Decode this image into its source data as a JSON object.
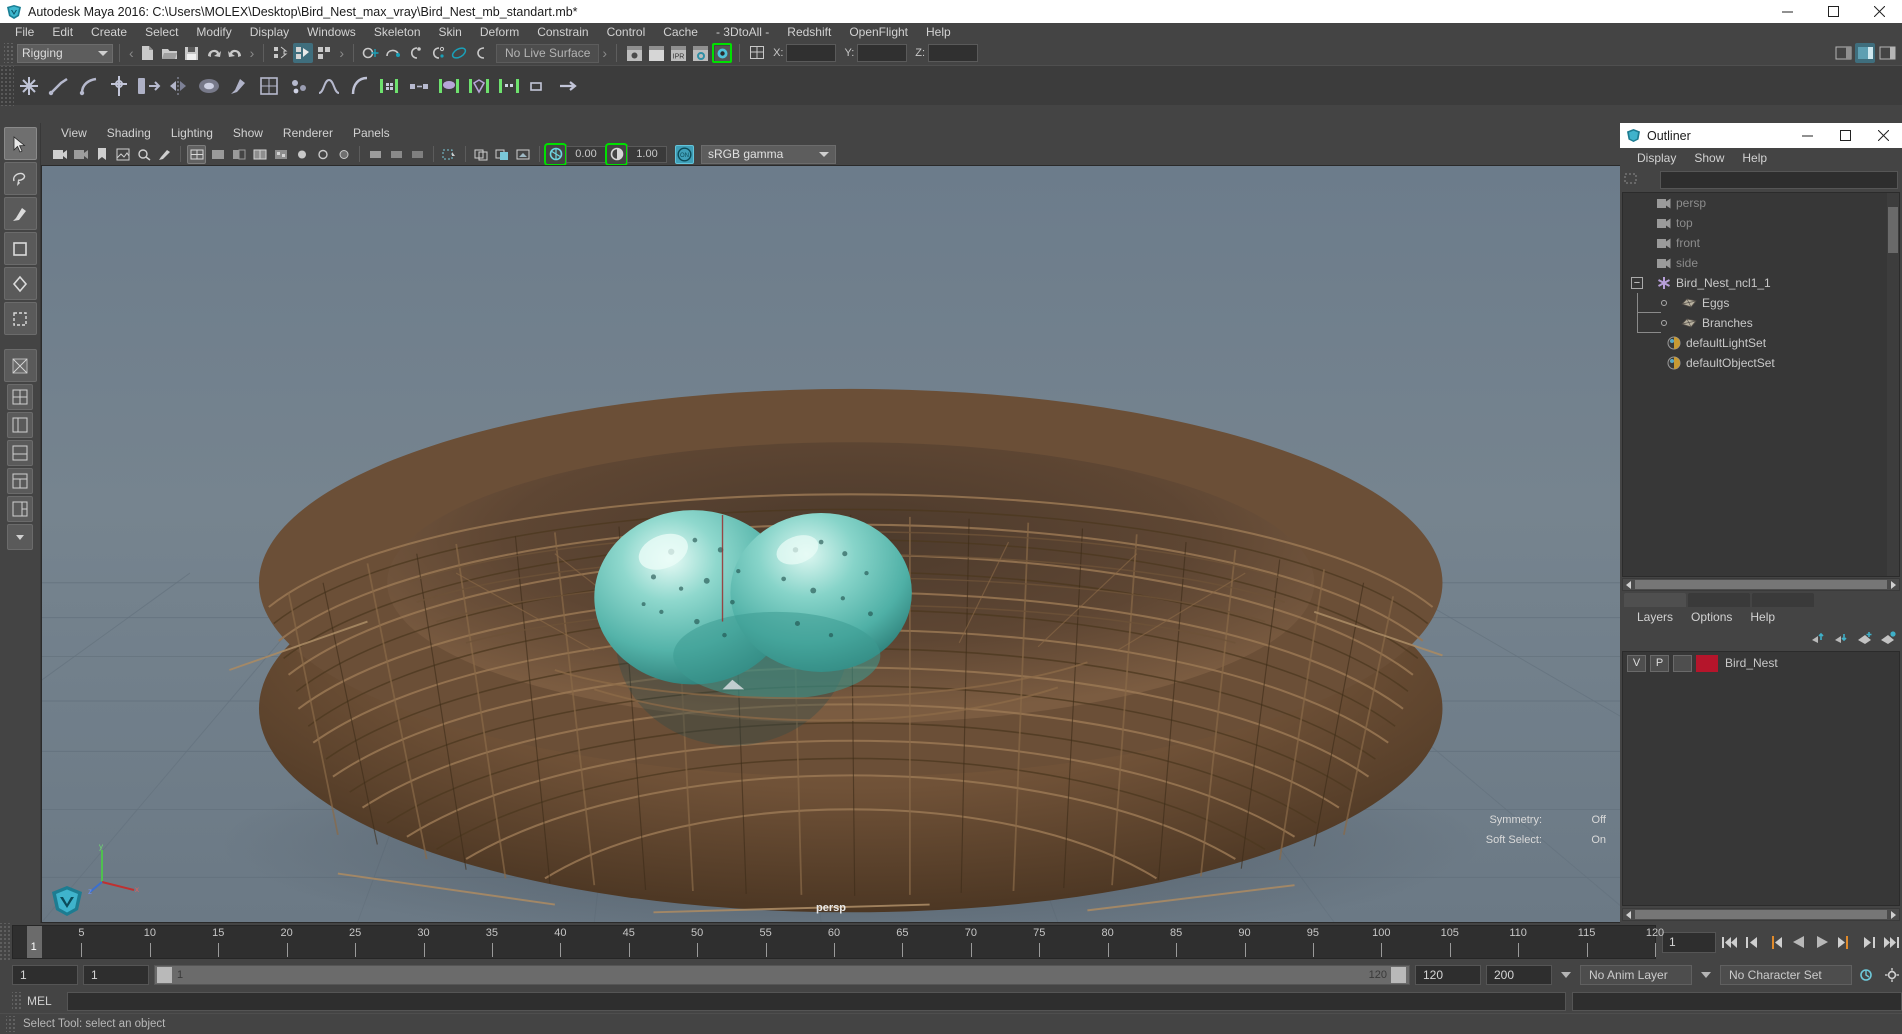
{
  "window": {
    "title": "Autodesk Maya 2016: C:\\Users\\MOLEX\\Desktop\\Bird_Nest_max_vray\\Bird_Nest_mb_standart.mb*",
    "minimize": "—",
    "maximize": "☐",
    "close": "✕"
  },
  "menubar": {
    "items": [
      "File",
      "Edit",
      "Create",
      "Select",
      "Modify",
      "Display",
      "Windows",
      "Skeleton",
      "Skin",
      "Deform",
      "Constrain",
      "Control",
      "Cache",
      "- 3DtoAll -",
      "Redshift",
      "OpenFlight",
      "Help"
    ]
  },
  "statusline": {
    "menuset": "Rigging",
    "live_surface": "No Live Surface",
    "coord_labels": [
      "X:",
      "Y:",
      "Z:"
    ],
    "coord_values": [
      "",
      "",
      ""
    ]
  },
  "viewport_menu": {
    "items": [
      "View",
      "Shading",
      "Lighting",
      "Show",
      "Renderer",
      "Panels"
    ]
  },
  "viewport_tools": {
    "exposure": "0.00",
    "gamma": "1.00",
    "color_profile": "sRGB gamma",
    "gamma_toggle": "ON"
  },
  "viewport": {
    "camera_label": "persp",
    "hud": [
      {
        "label": "Symmetry:",
        "value": "Off"
      },
      {
        "label": "Soft Select:",
        "value": "On"
      }
    ],
    "axis": {
      "x": "x",
      "y": "y",
      "z": "z"
    }
  },
  "outliner": {
    "title": "Outliner",
    "minimize": "—",
    "maximize": "☐",
    "close": "✕",
    "menu": [
      "Display",
      "Show",
      "Help"
    ],
    "search_value": "",
    "rows": [
      {
        "label": "persp",
        "icon": "camera-icon",
        "indent": 34,
        "dim": true,
        "expander": ""
      },
      {
        "label": "top",
        "icon": "camera-icon",
        "indent": 34,
        "dim": true,
        "expander": ""
      },
      {
        "label": "front",
        "icon": "camera-icon",
        "indent": 34,
        "dim": true,
        "expander": ""
      },
      {
        "label": "side",
        "icon": "camera-icon",
        "indent": 34,
        "dim": true,
        "expander": ""
      },
      {
        "label": "Bird_Nest_ncl1_1",
        "icon": "nucleus-icon",
        "indent": 34,
        "dim": false,
        "expander": "minus"
      },
      {
        "label": "Eggs",
        "icon": "mesh-icon",
        "indent": 58,
        "dim": false,
        "expander": "child"
      },
      {
        "label": "Branches",
        "icon": "mesh-icon",
        "indent": 58,
        "dim": false,
        "expander": "child"
      },
      {
        "label": "defaultLightSet",
        "icon": "set-icon",
        "indent": 44,
        "dim": false,
        "expander": ""
      },
      {
        "label": "defaultObjectSet",
        "icon": "set-icon",
        "indent": 44,
        "dim": false,
        "expander": ""
      }
    ]
  },
  "layers": {
    "menu": [
      "Layers",
      "Options",
      "Help"
    ],
    "toolbar_icons": [
      "move-layer-up-icon",
      "move-layer-down-icon",
      "new-layer-icon",
      "new-layer-from-selected-icon"
    ],
    "rows": [
      {
        "visibility": "V",
        "playback": "P",
        "color": "#b5152b",
        "name": "Bird_Nest"
      }
    ]
  },
  "timeline": {
    "ticks": [
      5,
      10,
      15,
      20,
      25,
      30,
      35,
      40,
      45,
      50,
      55,
      60,
      65,
      70,
      75,
      80,
      85,
      90,
      95,
      100,
      105,
      110,
      115,
      120
    ],
    "current_frame": "1",
    "current_frame_field": "1",
    "playback_buttons": [
      "go-to-start-icon",
      "step-back-key-icon",
      "step-back-frame-icon",
      "play-backwards-icon",
      "play-forwards-icon",
      "step-forward-frame-icon",
      "step-forward-key-icon",
      "go-to-end-icon"
    ]
  },
  "range": {
    "start": "1",
    "end": "1",
    "slider_left": "1",
    "slider_right": "120",
    "anim_start": "120",
    "anim_end": "200",
    "anim_layer": "No Anim Layer",
    "character_set": "No Character Set"
  },
  "command": {
    "prompt_label": "MEL",
    "input_value": "",
    "output_value": ""
  },
  "statusbar": {
    "help_text": "Select Tool: select an object"
  },
  "colors": {
    "accent_green": "#00e000",
    "accent_teal": "#3f9fb8",
    "layer_red": "#b5152b",
    "panel_bg": "#444444",
    "field_bg": "#2e2e2e"
  }
}
